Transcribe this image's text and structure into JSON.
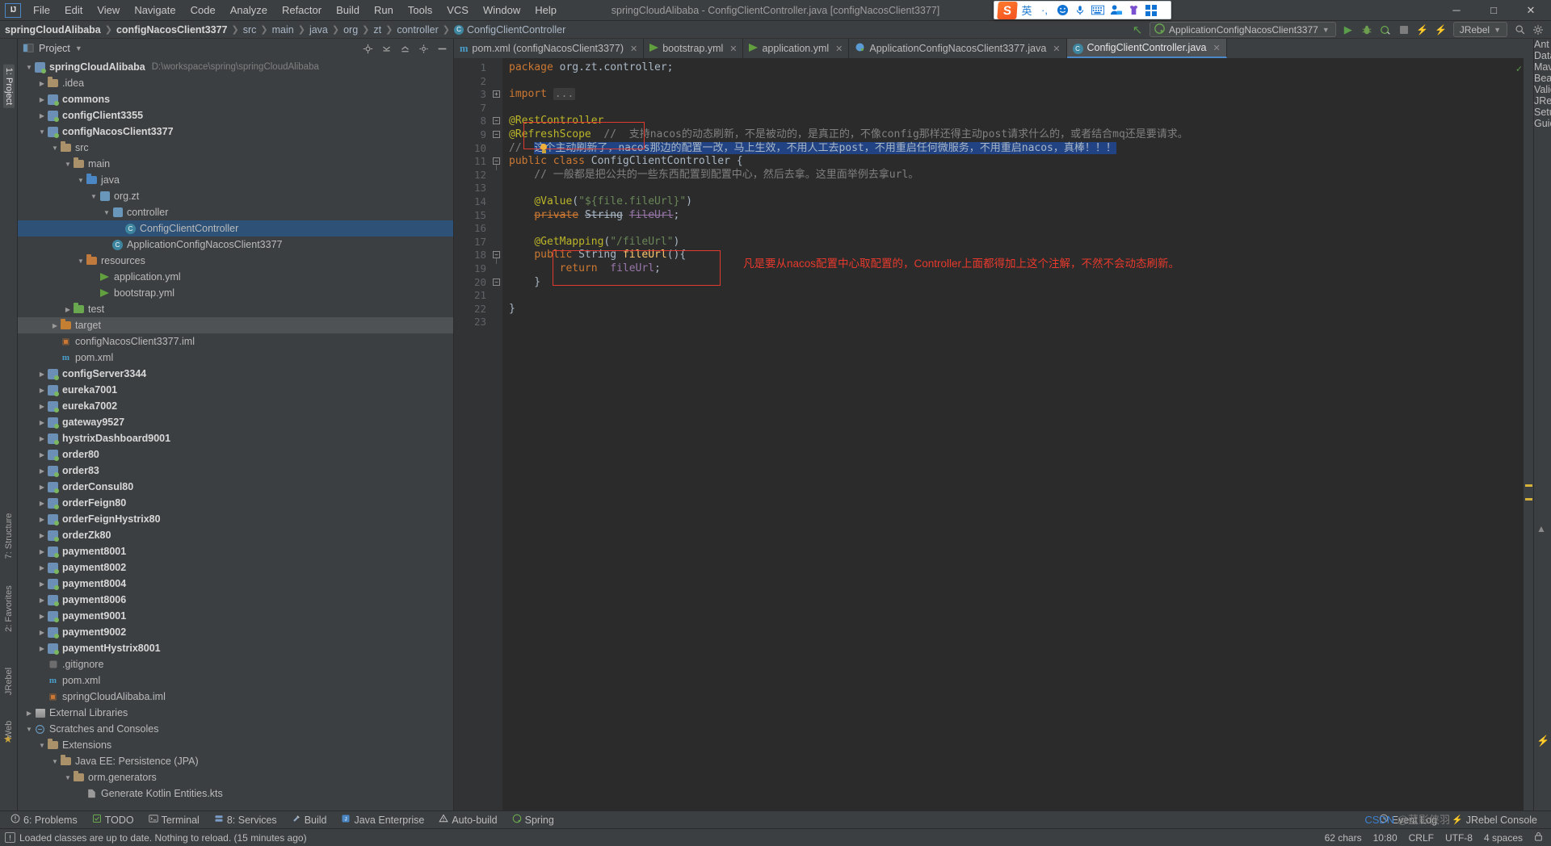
{
  "window": {
    "title": "springCloudAlibaba - ConfigClientController.java [configNacosClient3377]",
    "minimize": "─",
    "maximize": "□",
    "close": "✕"
  },
  "menu": [
    "File",
    "Edit",
    "View",
    "Navigate",
    "Code",
    "Analyze",
    "Refactor",
    "Build",
    "Run",
    "Tools",
    "VCS",
    "Window",
    "Help"
  ],
  "ime": {
    "logo": "S",
    "items": [
      "英",
      "·,",
      "☺",
      "mic",
      "keyboard",
      "user",
      "skin",
      "apps"
    ]
  },
  "breadcrumb": {
    "items": [
      "springCloudAlibaba",
      "configNacosClient3377",
      "src",
      "main",
      "java",
      "org",
      "zt",
      "controller"
    ],
    "class_name": "ConfigClientController",
    "class_icon": "C"
  },
  "toolbar": {
    "run_config": "ApplicationConfigNacosClient3377",
    "jrebel": "JRebel",
    "run": "▶",
    "debug": "debug-icon",
    "back_arrow": "↖"
  },
  "project_panel": {
    "title": "Project",
    "root": "springCloudAlibaba",
    "root_path": "D:\\workspace\\spring\\springCloudAlibaba",
    "tree": [
      {
        "depth": 0,
        "arrow": "down",
        "icon": "module",
        "label": "springCloudAlibaba",
        "bold": true,
        "path": "D:\\workspace\\spring\\springCloudAlibaba"
      },
      {
        "depth": 1,
        "arrow": "right",
        "icon": "folder",
        "label": ".idea"
      },
      {
        "depth": 1,
        "arrow": "right",
        "icon": "module",
        "label": "commons",
        "bold": true
      },
      {
        "depth": 1,
        "arrow": "right",
        "icon": "module",
        "label": "configClient3355",
        "bold": true
      },
      {
        "depth": 1,
        "arrow": "down",
        "icon": "module",
        "label": "configNacosClient3377",
        "bold": true
      },
      {
        "depth": 2,
        "arrow": "down",
        "icon": "folder",
        "label": "src"
      },
      {
        "depth": 3,
        "arrow": "down",
        "icon": "folder",
        "label": "main"
      },
      {
        "depth": 4,
        "arrow": "down",
        "icon": "src",
        "label": "java"
      },
      {
        "depth": 5,
        "arrow": "down",
        "icon": "pkg",
        "label": "org.zt"
      },
      {
        "depth": 6,
        "arrow": "down",
        "icon": "pkg",
        "label": "controller"
      },
      {
        "depth": 7,
        "arrow": "none",
        "icon": "java",
        "label": "ConfigClientController",
        "selected": true
      },
      {
        "depth": 6,
        "arrow": "none",
        "icon": "java",
        "label": "ApplicationConfigNacosClient3377"
      },
      {
        "depth": 4,
        "arrow": "down",
        "icon": "res",
        "label": "resources"
      },
      {
        "depth": 5,
        "arrow": "none",
        "icon": "yml",
        "label": "application.yml"
      },
      {
        "depth": 5,
        "arrow": "none",
        "icon": "yml",
        "label": "bootstrap.yml"
      },
      {
        "depth": 3,
        "arrow": "right",
        "icon": "test",
        "label": "test"
      },
      {
        "depth": 2,
        "arrow": "right",
        "icon": "tgt",
        "label": "target",
        "selected2": true
      },
      {
        "depth": 2,
        "arrow": "none",
        "icon": "iml",
        "label": "configNacosClient3377.iml"
      },
      {
        "depth": 2,
        "arrow": "none",
        "icon": "mvn",
        "label": "pom.xml"
      },
      {
        "depth": 1,
        "arrow": "right",
        "icon": "module",
        "label": "configServer3344",
        "bold": true
      },
      {
        "depth": 1,
        "arrow": "right",
        "icon": "module",
        "label": "eureka7001",
        "bold": true
      },
      {
        "depth": 1,
        "arrow": "right",
        "icon": "module",
        "label": "eureka7002",
        "bold": true
      },
      {
        "depth": 1,
        "arrow": "right",
        "icon": "module",
        "label": "gateway9527",
        "bold": true
      },
      {
        "depth": 1,
        "arrow": "right",
        "icon": "module",
        "label": "hystrixDashboard9001",
        "bold": true
      },
      {
        "depth": 1,
        "arrow": "right",
        "icon": "module",
        "label": "order80",
        "bold": true
      },
      {
        "depth": 1,
        "arrow": "right",
        "icon": "module",
        "label": "order83",
        "bold": true
      },
      {
        "depth": 1,
        "arrow": "right",
        "icon": "module",
        "label": "orderConsul80",
        "bold": true
      },
      {
        "depth": 1,
        "arrow": "right",
        "icon": "module",
        "label": "orderFeign80",
        "bold": true
      },
      {
        "depth": 1,
        "arrow": "right",
        "icon": "module",
        "label": "orderFeignHystrix80",
        "bold": true
      },
      {
        "depth": 1,
        "arrow": "right",
        "icon": "module",
        "label": "orderZk80",
        "bold": true
      },
      {
        "depth": 1,
        "arrow": "right",
        "icon": "module",
        "label": "payment8001",
        "bold": true
      },
      {
        "depth": 1,
        "arrow": "right",
        "icon": "module",
        "label": "payment8002",
        "bold": true
      },
      {
        "depth": 1,
        "arrow": "right",
        "icon": "module",
        "label": "payment8004",
        "bold": true
      },
      {
        "depth": 1,
        "arrow": "right",
        "icon": "module",
        "label": "payment8006",
        "bold": true
      },
      {
        "depth": 1,
        "arrow": "right",
        "icon": "module",
        "label": "payment9001",
        "bold": true
      },
      {
        "depth": 1,
        "arrow": "right",
        "icon": "module",
        "label": "payment9002",
        "bold": true
      },
      {
        "depth": 1,
        "arrow": "right",
        "icon": "module",
        "label": "paymentHystrix8001",
        "bold": true
      },
      {
        "depth": 1,
        "arrow": "none",
        "icon": "git",
        "label": ".gitignore"
      },
      {
        "depth": 1,
        "arrow": "none",
        "icon": "mvn",
        "label": "pom.xml"
      },
      {
        "depth": 1,
        "arrow": "none",
        "icon": "iml",
        "label": "springCloudAlibaba.iml"
      },
      {
        "depth": 0,
        "arrow": "right",
        "icon": "lib",
        "label": "External Libraries"
      },
      {
        "depth": 0,
        "arrow": "down",
        "icon": "scratch",
        "label": "Scratches and Consoles"
      },
      {
        "depth": 1,
        "arrow": "down",
        "icon": "folder",
        "label": "Extensions"
      },
      {
        "depth": 2,
        "arrow": "down",
        "icon": "folder",
        "label": "Java EE: Persistence (JPA)"
      },
      {
        "depth": 3,
        "arrow": "down",
        "icon": "folder",
        "label": "orm.generators"
      },
      {
        "depth": 4,
        "arrow": "none",
        "icon": "file",
        "label": "Generate Kotlin Entities.kts"
      }
    ]
  },
  "tabs": [
    {
      "label": "pom.xml (configNacosClient3377)",
      "icon": "maven-icon",
      "active": false
    },
    {
      "label": "bootstrap.yml",
      "icon": "yml-icon",
      "active": false
    },
    {
      "label": "application.yml",
      "icon": "yml-icon",
      "active": false
    },
    {
      "label": "ApplicationConfigNacosClient3377.java",
      "icon": "spring-icon",
      "active": false
    },
    {
      "label": "ConfigClientController.java",
      "icon": "java-icon",
      "active": true
    }
  ],
  "editor": {
    "line_numbers": [
      "1",
      "2",
      "3",
      "7",
      "8",
      "9",
      "10",
      "11",
      "12",
      "13",
      "14",
      "15",
      "16",
      "17",
      "18",
      "19",
      "20",
      "21",
      "22",
      "23"
    ],
    "lines": [
      {
        "n": "1",
        "segments": [
          {
            "t": "kw",
            "v": "package"
          },
          {
            "t": "txt",
            "v": " org.zt.controller;"
          }
        ]
      },
      {
        "n": "2",
        "segments": []
      },
      {
        "n": "3",
        "segments": [
          {
            "t": "kw",
            "v": "import"
          },
          {
            "t": "txt",
            "v": " "
          },
          {
            "t": "dots",
            "v": "..."
          }
        ]
      },
      {
        "n": "7",
        "segments": []
      },
      {
        "n": "8",
        "segments": [
          {
            "t": "ann",
            "v": "@RestController"
          }
        ]
      },
      {
        "n": "9",
        "segments": [
          {
            "t": "ann",
            "v": "@RefreshScope"
          },
          {
            "t": "txt",
            "v": "  "
          },
          {
            "t": "cmt",
            "v": "//  支持nacos的动态刷新，不是被动的，是真正的，不像config那样还得主动post请求什么的，或者结合mq还是要请求。"
          }
        ]
      },
      {
        "n": "10",
        "segments": [
          {
            "t": "cmt",
            "v": "//  "
          },
          {
            "t": "sel",
            "v": "这个主动刷新了，nacos那边的配置一改，马上生效，不用人工去post，不用重启任何微服务，不用重启nacos，真棒！！！"
          }
        ]
      },
      {
        "n": "11",
        "segments": [
          {
            "t": "kw",
            "v": "public"
          },
          {
            "t": "txt",
            "v": " "
          },
          {
            "t": "kw",
            "v": "class"
          },
          {
            "t": "txt",
            "v": " ConfigClientController {"
          }
        ]
      },
      {
        "n": "12",
        "segments": [
          {
            "t": "cmt",
            "v": "    // 一般都是把公共的一些东西配置到配置中心，然后去拿。这里面举例去拿url。"
          }
        ]
      },
      {
        "n": "13",
        "segments": []
      },
      {
        "n": "14",
        "segments": [
          {
            "t": "txt",
            "v": "    "
          },
          {
            "t": "ann",
            "v": "@Value"
          },
          {
            "t": "txt",
            "v": "("
          },
          {
            "t": "str",
            "v": "\"${file.fileUrl}\""
          },
          {
            "t": "txt",
            "v": ")"
          }
        ]
      },
      {
        "n": "15",
        "segments": [
          {
            "t": "txt",
            "v": "    "
          },
          {
            "t": "kwstrike",
            "v": "private"
          },
          {
            "t": "txt",
            "v": " "
          },
          {
            "t": "txtstrike",
            "v": "String"
          },
          {
            "t": "txt",
            "v": " "
          },
          {
            "t": "fldstrike",
            "v": "fileUrl"
          },
          {
            "t": "txt",
            "v": ";"
          }
        ]
      },
      {
        "n": "16",
        "segments": []
      },
      {
        "n": "17",
        "segments": [
          {
            "t": "txt",
            "v": "    "
          },
          {
            "t": "ann",
            "v": "@GetMapping"
          },
          {
            "t": "txt",
            "v": "("
          },
          {
            "t": "str",
            "v": "\"/fileUrl\""
          },
          {
            "t": "txt",
            "v": ")"
          }
        ]
      },
      {
        "n": "18",
        "segments": [
          {
            "t": "txt",
            "v": "    "
          },
          {
            "t": "kw",
            "v": "public"
          },
          {
            "t": "txt",
            "v": " String "
          },
          {
            "t": "mth",
            "v": "fileUrl"
          },
          {
            "t": "txt",
            "v": "(){"
          }
        ]
      },
      {
        "n": "19",
        "segments": [
          {
            "t": "txt",
            "v": "        "
          },
          {
            "t": "kw",
            "v": "return"
          },
          {
            "t": "txt",
            "v": "  "
          },
          {
            "t": "fld",
            "v": "fileUrl"
          },
          {
            "t": "txt",
            "v": ";"
          }
        ]
      },
      {
        "n": "20",
        "segments": [
          {
            "t": "txt",
            "v": "    }"
          }
        ]
      },
      {
        "n": "21",
        "segments": []
      },
      {
        "n": "22",
        "segments": [
          {
            "t": "txt",
            "v": "}"
          }
        ]
      },
      {
        "n": "23",
        "segments": []
      }
    ],
    "annotation_red": "凡是要从nacos配置中心取配置的，Controller上面都得加上这个注解，不然不会动态刷新。",
    "ok_check": "✓"
  },
  "left_rail": [
    {
      "label": "1: Project",
      "selected": true
    },
    {
      "label": "7: Structure"
    },
    {
      "label": "2: Favorites"
    },
    {
      "label": "JRebel"
    },
    {
      "label": "Web"
    }
  ],
  "right_rail": [
    {
      "label": "Ant"
    },
    {
      "label": "Database"
    },
    {
      "label": "Maven"
    },
    {
      "label": "Bean Validation"
    },
    {
      "label": "JRebel Setup Guide"
    }
  ],
  "bottom_tools": [
    {
      "label": "6: Problems",
      "icon": "problems-icon"
    },
    {
      "label": "TODO",
      "icon": "todo-icon"
    },
    {
      "label": "Terminal",
      "icon": "terminal-icon"
    },
    {
      "label": "8: Services",
      "icon": "services-icon"
    },
    {
      "label": "Build",
      "icon": "build-icon"
    },
    {
      "label": "Java Enterprise",
      "icon": "javaee-icon"
    },
    {
      "label": "Auto-build",
      "icon": "warning-icon"
    },
    {
      "label": "Spring",
      "icon": "spring-icon"
    }
  ],
  "bottom_right_tools": [
    {
      "label": "Event Log",
      "icon": "event-log-icon"
    },
    {
      "label": "JRebel Console",
      "icon": "jrebel-icon"
    }
  ],
  "status": {
    "message": "Loaded classes are up to date. Nothing to reload. (15 minutes ago)",
    "chars": "62 chars",
    "caret": "10:80",
    "line_sep": "CRLF",
    "encoding": "UTF-8",
    "indent": "4 spaces",
    "lock": "lock-icon"
  },
  "watermark": {
    "csdn": "CSDN",
    "author": "@蓝影侠羽"
  },
  "colors": {
    "accent": "#4a88c7",
    "selection": "#214283",
    "tree_selection": "#2d5177",
    "annotation_red": "#e8392c",
    "editor_bg": "#2b2b2b",
    "panel_bg": "#3c3f41"
  }
}
